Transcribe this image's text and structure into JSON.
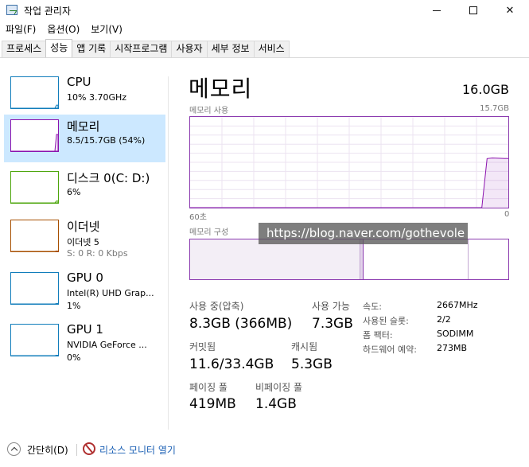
{
  "window": {
    "title": "작업 관리자"
  },
  "menu": [
    "파일(F)",
    "옵션(O)",
    "보기(V)"
  ],
  "tabs": [
    "프로세스",
    "성능",
    "앱 기록",
    "시작프로그램",
    "사용자",
    "세부 정보",
    "서비스"
  ],
  "active_tab": "성능",
  "devices": [
    {
      "name": "CPU",
      "sub1": "10% 3.70GHz",
      "sub2": "",
      "color": "#117dbb",
      "usage": 0.1
    },
    {
      "name": "메모리",
      "sub1": "8.5/15.7GB (54%)",
      "sub2": "",
      "color": "#8b12ae",
      "usage": 0.54
    },
    {
      "name": "디스크 0(C: D:)",
      "sub1": "6%",
      "sub2": "",
      "color": "#4da60c",
      "usage": 0.06
    },
    {
      "name": "이더넷",
      "sub1": "이더넷 5",
      "sub2": "S: 0 R: 0 Kbps",
      "color": "#a74f01",
      "usage": 0.0
    },
    {
      "name": "GPU 0",
      "sub1": "Intel(R) UHD Grap...",
      "sub2": "1%",
      "color": "#117dbb",
      "usage": 0.01
    },
    {
      "name": "GPU 1",
      "sub1": "NVIDIA GeForce ...",
      "sub2": "0%",
      "color": "#117dbb",
      "usage": 0.0
    }
  ],
  "main": {
    "title": "메모리",
    "total": "16.0GB",
    "usage_label": "메모리 사용",
    "usage_max": "15.7GB",
    "time_left": "60초",
    "time_right": "0",
    "composition_label": "메모리 구성",
    "in_use_label": "사용 중(압축)",
    "in_use_value": "8.3GB (366MB)",
    "available_label": "사용 가능",
    "available_value": "7.3GB",
    "committed_label": "커밋됨",
    "committed_value": "11.6/33.4GB",
    "cached_label": "캐시됨",
    "cached_value": "5.3GB",
    "paged_label": "페이징 풀",
    "paged_value": "419MB",
    "nonpaged_label": "비페이징 풀",
    "nonpaged_value": "1.4GB",
    "details": [
      {
        "label": "속도:",
        "value": "2667MHz"
      },
      {
        "label": "사용된 슬롯:",
        "value": "2/2"
      },
      {
        "label": "폼 팩터:",
        "value": "SODIMM"
      },
      {
        "label": "하드웨어 예약:",
        "value": "273MB"
      }
    ]
  },
  "watermark": "https://blog.naver.com/gothevole",
  "footer": {
    "fewer_details": "간단히(D)",
    "resource_monitor": "리소스 모니터 열기"
  },
  "chart_data": {
    "type": "area",
    "title": "메모리 사용",
    "ylim": [
      0,
      15.7
    ],
    "x_range_seconds": [
      60,
      0
    ],
    "series": [
      {
        "x": [
          60,
          5,
          4,
          3,
          0
        ],
        "values": [
          0,
          0,
          8.5,
          8.6,
          8.5
        ]
      }
    ]
  }
}
